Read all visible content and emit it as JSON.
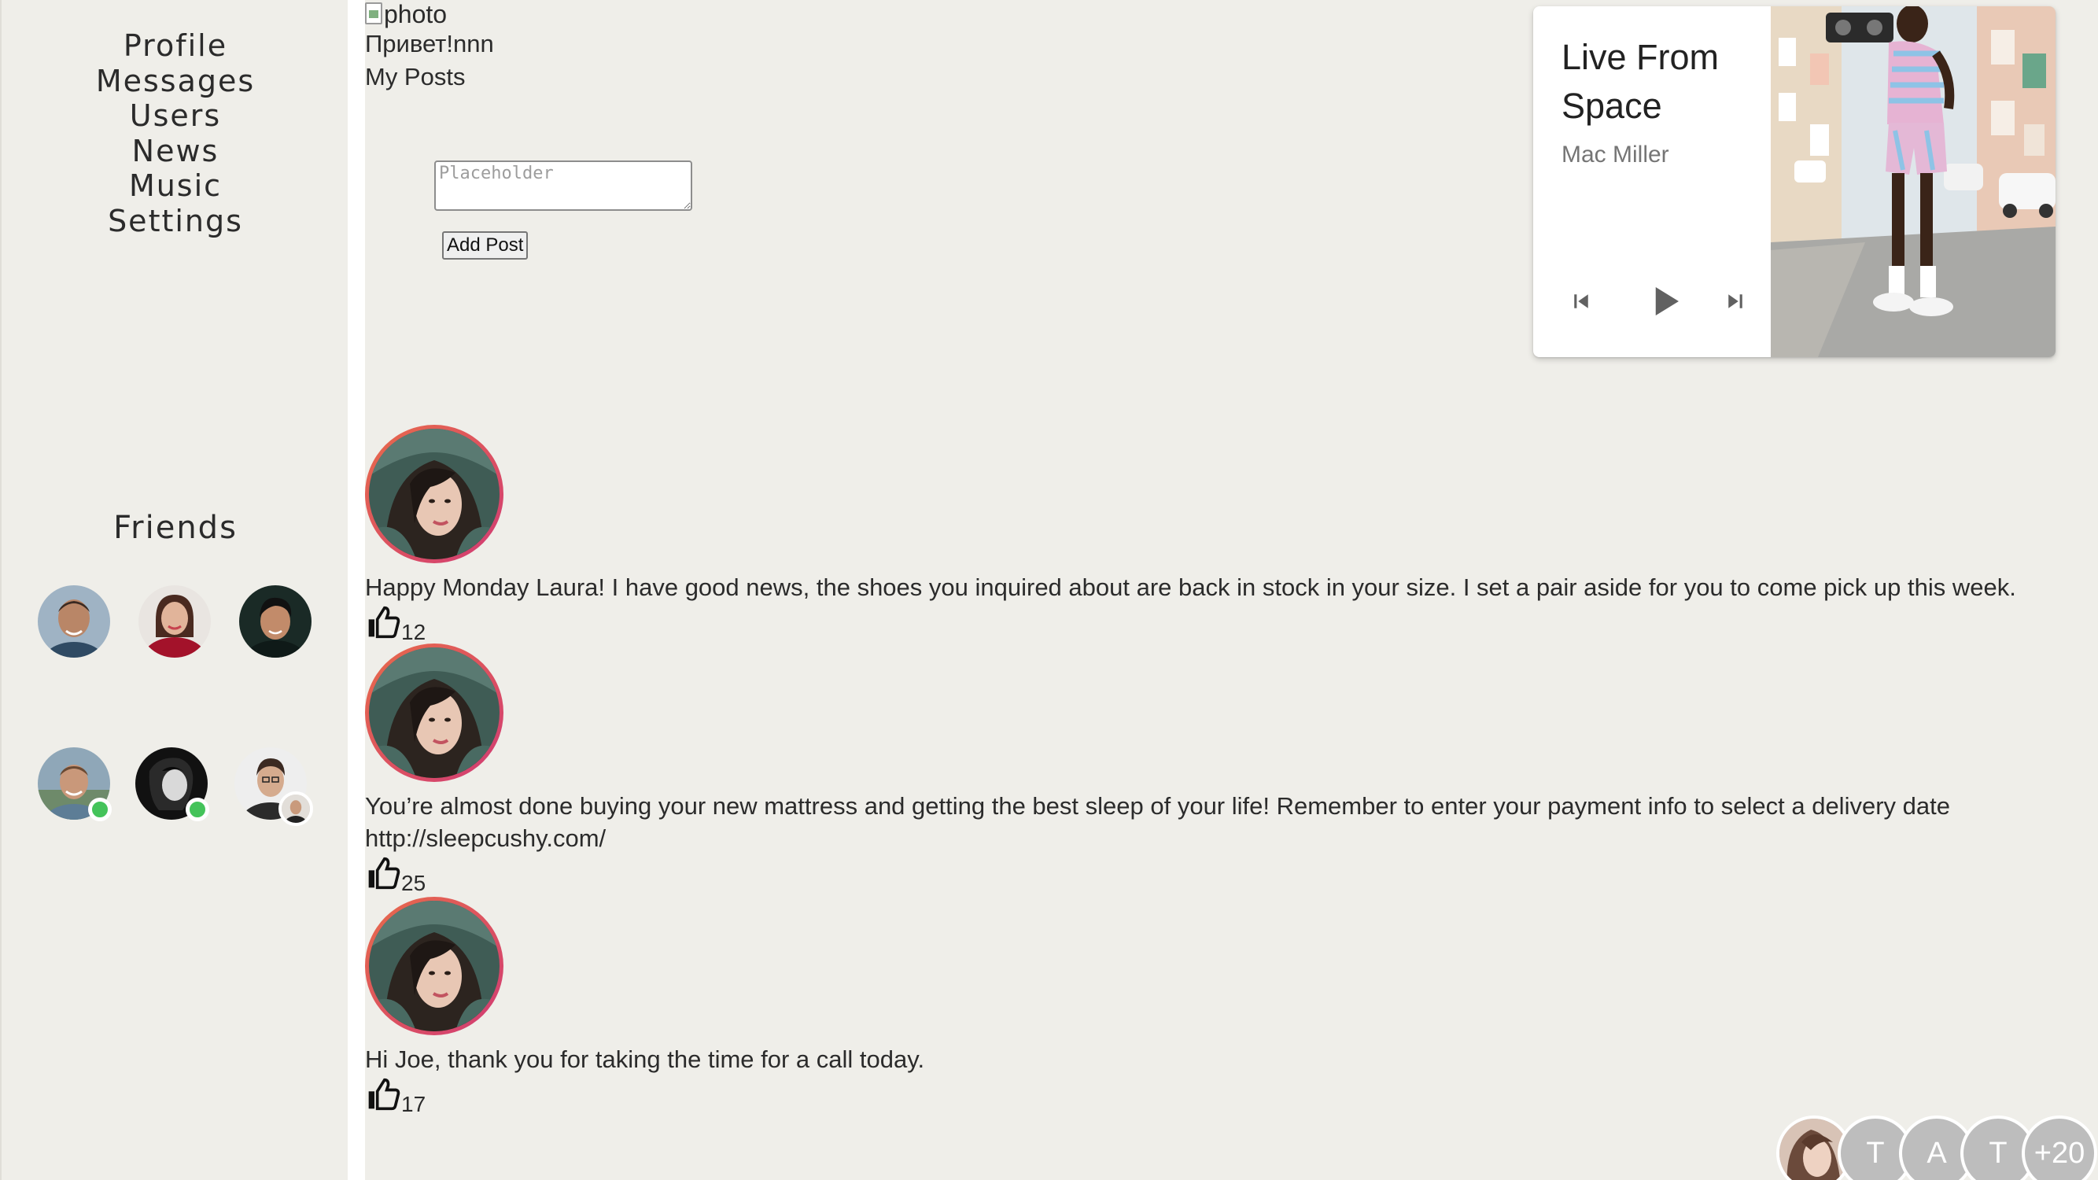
{
  "sidebar": {
    "nav": [
      {
        "label": "Profile"
      },
      {
        "label": "Messages"
      },
      {
        "label": "Users"
      },
      {
        "label": "News"
      },
      {
        "label": "Music"
      },
      {
        "label": "Settings"
      }
    ],
    "friends_title": "Friends",
    "friends": [
      {
        "status": "none"
      },
      {
        "status": "none"
      },
      {
        "status": "none"
      },
      {
        "status": "online"
      },
      {
        "status": "online"
      },
      {
        "status": "badge-avatar"
      }
    ]
  },
  "profile": {
    "photo_alt": "photo",
    "greeting": "Привет!nnn",
    "my_posts_label": "My Posts"
  },
  "composer": {
    "placeholder": "Placeholder",
    "value": "",
    "add_post_label": "Add Post"
  },
  "player": {
    "title": "Live From Space",
    "artist": "Mac Miller",
    "controls": [
      "skip-previous-icon",
      "play-icon",
      "skip-next-icon"
    ]
  },
  "posts": [
    {
      "message": "Happy Monday Laura! I have good news, the shoes you inquired about are back in stock in your size. I set a pair aside for you to come pick up this week.",
      "link": "",
      "likes": "12"
    },
    {
      "message": "You’re almost done buying your new mattress and getting the best sleep of your life! Remember to enter your payment info to select a delivery date",
      "link": "http://sleepcushy.com/",
      "likes": "25"
    },
    {
      "message": "Hi Joe, thank you for taking the time for a call today.",
      "link": "",
      "likes": "17"
    }
  ],
  "avatar_group": {
    "letters": [
      "T",
      "A",
      "T"
    ],
    "more": "+20"
  },
  "colors": {
    "background": "#efeee9",
    "online": "#44c35a",
    "avatar_ring_start": "#e86b4a",
    "avatar_ring_end": "#d13b74",
    "group_avatar": "#bdbdbd"
  }
}
